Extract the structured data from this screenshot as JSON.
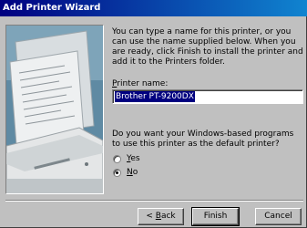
{
  "window": {
    "title": "Add Printer Wizard"
  },
  "intro": {
    "text": "You can type a name for this printer, or you can use the name supplied below. When you are ready, click Finish to install the printer and add it to the Printers folder."
  },
  "printer_name": {
    "label_prefix": "",
    "label_accel": "P",
    "label_rest": "rinter name:",
    "value": "Brother PT-9200DX"
  },
  "default_question": {
    "text": "Do you want your Windows-based programs to use this printer as the default printer?"
  },
  "options": {
    "yes_accel": "Y",
    "yes_rest": "es",
    "no_accel": "N",
    "no_rest": "o",
    "selected": "No"
  },
  "buttons": {
    "back_prefix": "< ",
    "back_accel": "B",
    "back_rest": "ack",
    "finish": "Finish",
    "cancel": "Cancel"
  },
  "colors": {
    "title_start": "#000080",
    "title_end": "#1084d0",
    "face": "#c0c0c0",
    "art_bg": "#5f8aa3"
  }
}
